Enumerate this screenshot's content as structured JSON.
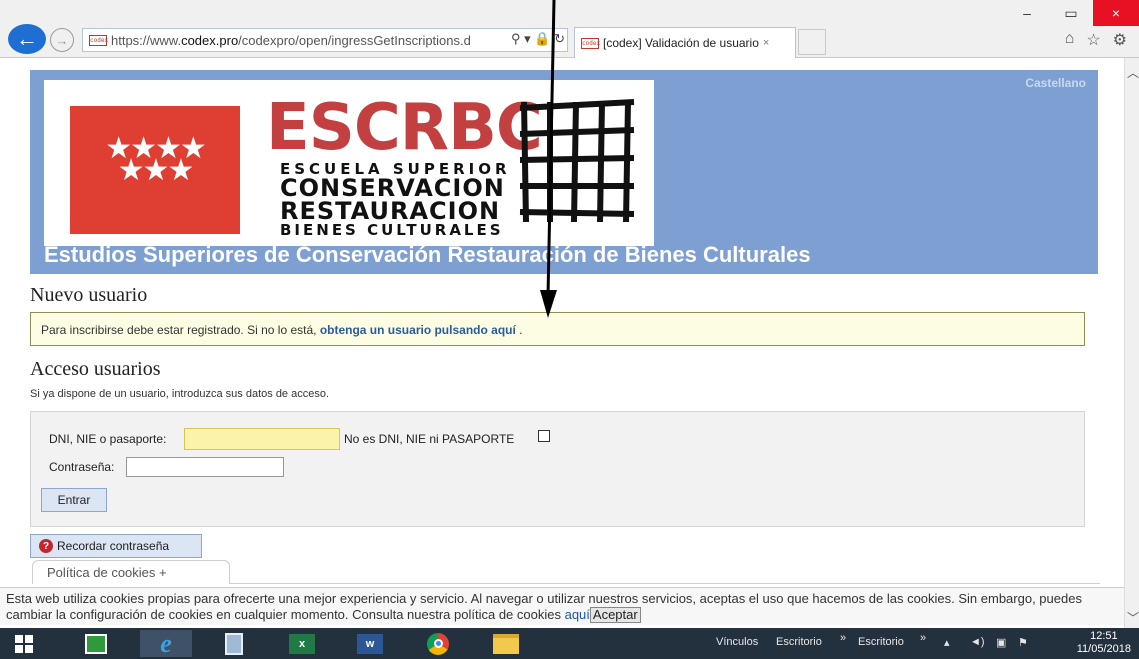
{
  "browser": {
    "url_protocol": "https://www.",
    "url_host": "codex.pro",
    "url_path": "/codexpro/open/ingressGetInscriptions.d",
    "favicon_text": "codex",
    "tab_title": "[codex] Validación de usuario",
    "tab_close": "×",
    "window_buttons": [
      "–",
      "▭",
      "×"
    ]
  },
  "header": {
    "language": "Castellano",
    "logo_main": "ESCRBC",
    "logo_line1": "ESCUELA SUPERIOR",
    "logo_line2": "CONSERVACION",
    "logo_line3": "RESTAURACION",
    "logo_line4": "BIENES CULTURALES",
    "stars": "★★★★\n★★★",
    "site_title": "Estudios Superiores de Conservación Restauración de Bienes Culturales"
  },
  "new_user": {
    "heading": "Nuevo usuario",
    "notice_text": "Para inscribirse debe estar registrado. Si no lo está, ",
    "notice_link": "obtenga un usuario pulsando aquí",
    "notice_end": " ."
  },
  "login": {
    "heading": "Acceso usuarios",
    "description": "Si ya dispone de un usuario, introduzca sus datos de acceso.",
    "dni_label": "DNI, NIE o pasaporte:",
    "dni_value": "",
    "dni_alt_label": "No es DNI, NIE ni PASAPORTE",
    "password_label": "Contraseña:",
    "password_value": "",
    "submit_label": "Entrar",
    "remember_label": "Recordar contraseña",
    "cookie_tab_label": "Política de cookies +"
  },
  "cookie_banner": {
    "text": "Esta web utiliza cookies propias para ofrecerte una mejor experiencia y servicio. Al navegar o utilizar nuestros servicios, aceptas el uso que hacemos de las cookies. Sin embargo, puedes cambiar la configuración de cookies en cualquier momento. Consulta nuestra política de cookies ",
    "link": "aquí",
    "accept_label": "Aceptar"
  },
  "taskbar": {
    "links_label": "Vínculos",
    "desktop_label_1": "Escritorio",
    "desktop_label_2": "Escritorio",
    "time": "12:51",
    "date": "11/05/2018"
  },
  "colors": {
    "header_bg": "#7e9fd2",
    "notice_bg": "#fdfde4",
    "dni_input_bg": "#fbf3a9",
    "link": "#2a5c9c",
    "taskbar": "#23313f"
  }
}
